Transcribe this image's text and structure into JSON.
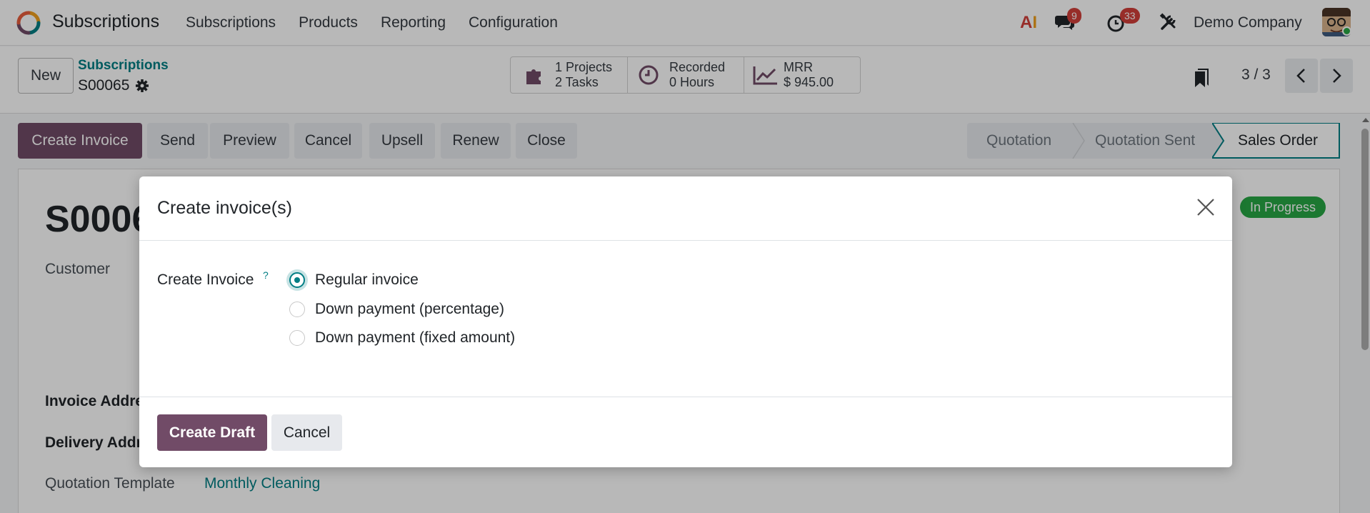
{
  "navbar": {
    "app_name": "Subscriptions",
    "menu": [
      "Subscriptions",
      "Products",
      "Reporting",
      "Configuration"
    ],
    "ai_label": "AI",
    "messages_count": "9",
    "activities_count": "33",
    "company": "Demo Company"
  },
  "control_panel": {
    "new_label": "New",
    "breadcrumb_parent": "Subscriptions",
    "breadcrumb_current": "S00065",
    "stats": [
      {
        "line1": "1 Projects",
        "line2": "2 Tasks",
        "icon": "puzzle-icon"
      },
      {
        "line1": "Recorded",
        "line2": "0 Hours",
        "icon": "clock-icon"
      },
      {
        "line1": "MRR",
        "line2": "$ 945.00",
        "icon": "chart-line-icon"
      }
    ],
    "pager": "3 / 3"
  },
  "actions": [
    "Create Invoice",
    "Send",
    "Preview",
    "Cancel",
    "Upsell",
    "Renew",
    "Close"
  ],
  "status_stages": [
    "Quotation",
    "Quotation Sent",
    "Sales Order"
  ],
  "status_active": "Sales Order",
  "form": {
    "title": "S0006",
    "ribbon": "In Progress",
    "customer_label": "Customer",
    "invoice_address_label": "Invoice Addre",
    "delivery_address_label": "Delivery Addr",
    "quotation_template_label": "Quotation Template",
    "quotation_template_value": "Monthly Cleaning"
  },
  "modal": {
    "title": "Create invoice(s)",
    "field_label": "Create Invoice",
    "help_mark": "?",
    "options": [
      "Regular invoice",
      "Down payment (percentage)",
      "Down payment (fixed amount)"
    ],
    "selected": "Regular invoice",
    "create_draft_label": "Create Draft",
    "cancel_label": "Cancel"
  },
  "colors": {
    "primary": "#714b67",
    "accent": "#017e84",
    "badge": "#d23f3a",
    "ribbon": "#28a745"
  }
}
